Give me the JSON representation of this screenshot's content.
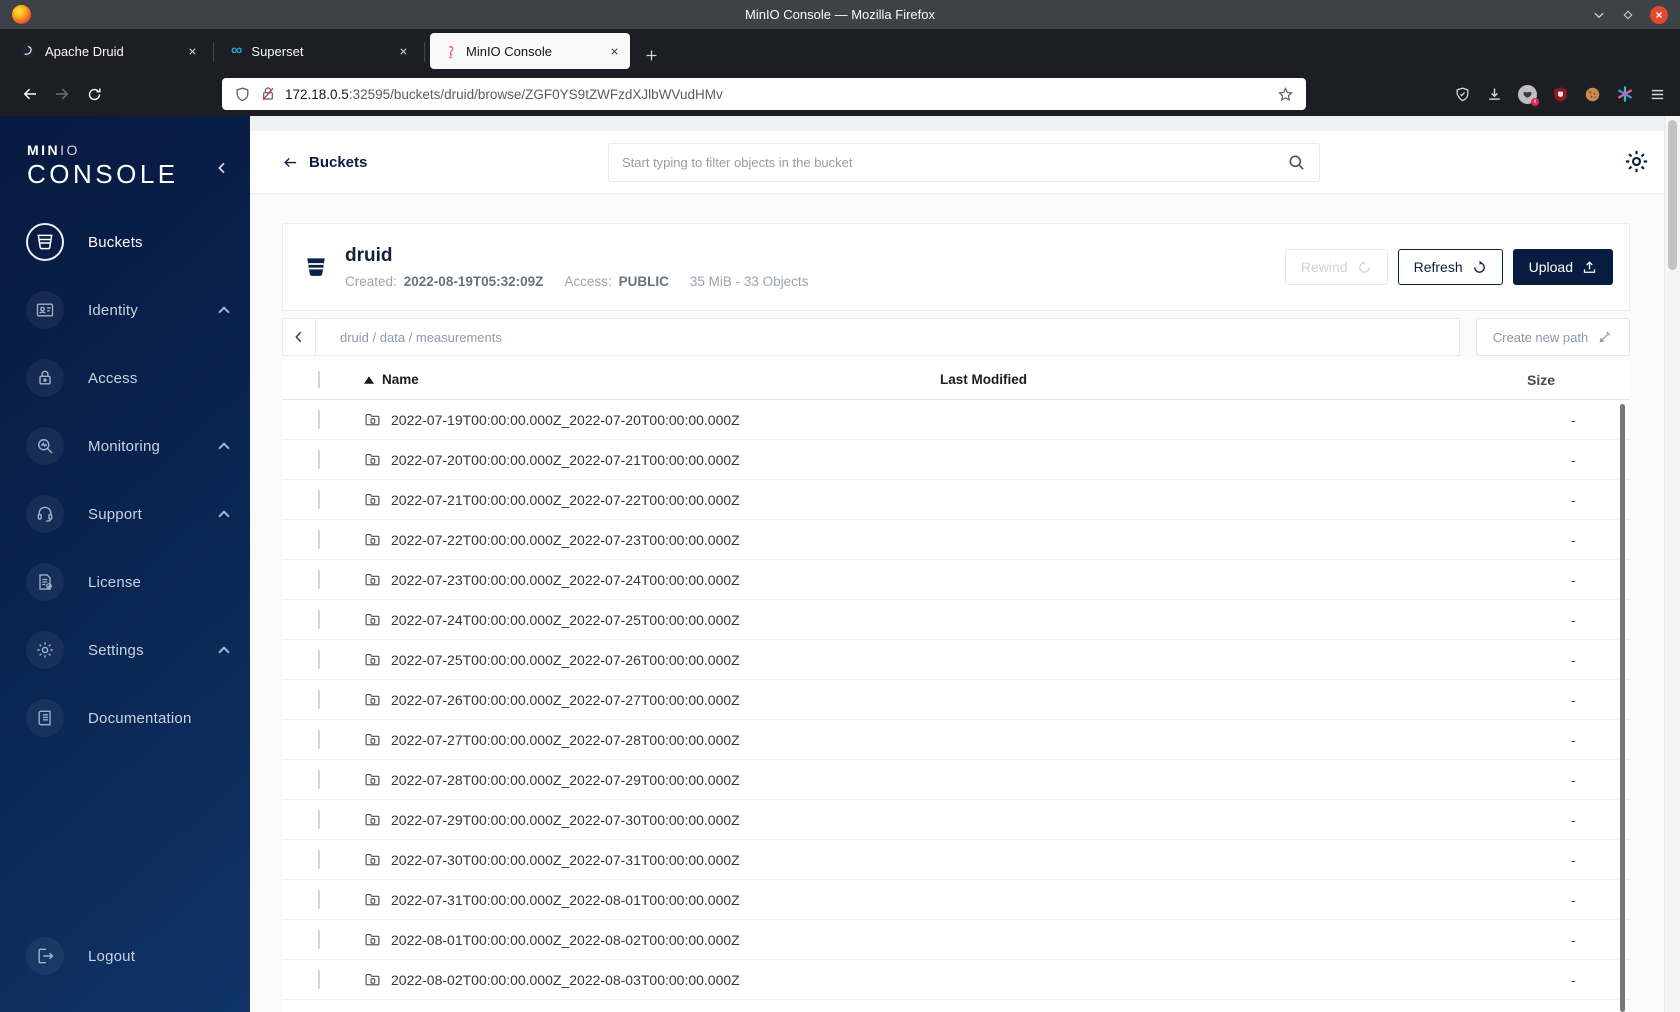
{
  "window": {
    "title": "MinIO Console — Mozilla Firefox"
  },
  "tabs": [
    {
      "label": "Apache Druid"
    },
    {
      "label": "Superset"
    },
    {
      "label": "MinIO Console",
      "active": true
    }
  ],
  "urlbar": {
    "host": "172.18.0.5",
    "rest": ":32595/buckets/druid/browse/ZGF0YS9tZWFzdXJlbWVudHMv"
  },
  "sidebar": {
    "logo_primary": "MIN",
    "logo_secondary": "IO",
    "logo_word": "CONSOLE",
    "items": [
      {
        "label": "Buckets",
        "icon": "bucket",
        "active": true,
        "expandable": false
      },
      {
        "label": "Identity",
        "icon": "identity",
        "active": false,
        "expandable": true
      },
      {
        "label": "Access",
        "icon": "access",
        "active": false,
        "expandable": false
      },
      {
        "label": "Monitoring",
        "icon": "monitoring",
        "active": false,
        "expandable": true
      },
      {
        "label": "Support",
        "icon": "support",
        "active": false,
        "expandable": true
      },
      {
        "label": "License",
        "icon": "license",
        "active": false,
        "expandable": false
      },
      {
        "label": "Settings",
        "icon": "settings",
        "active": false,
        "expandable": true
      },
      {
        "label": "Documentation",
        "icon": "documentation",
        "active": false,
        "expandable": false
      }
    ],
    "logout_label": "Logout"
  },
  "header": {
    "back_label": "Buckets",
    "search_placeholder": "Start typing to filter objects in the bucket"
  },
  "bucket": {
    "name": "druid",
    "created_label": "Created:",
    "created_value": "2022-08-19T05:32:09Z",
    "access_label": "Access:",
    "access_value": "PUBLIC",
    "usage": "35 MiB - 33 Objects",
    "actions": {
      "rewind": "Rewind",
      "refresh": "Refresh",
      "upload": "Upload"
    }
  },
  "browse": {
    "breadcrumb": "druid / data / measurements",
    "create_path_label": "Create new path",
    "columns": {
      "name": "Name",
      "last_modified": "Last Modified",
      "size": "Size"
    },
    "rows": [
      {
        "name": "2022-07-19T00:00:00.000Z_2022-07-20T00:00:00.000Z",
        "size": "-"
      },
      {
        "name": "2022-07-20T00:00:00.000Z_2022-07-21T00:00:00.000Z",
        "size": "-"
      },
      {
        "name": "2022-07-21T00:00:00.000Z_2022-07-22T00:00:00.000Z",
        "size": "-"
      },
      {
        "name": "2022-07-22T00:00:00.000Z_2022-07-23T00:00:00.000Z",
        "size": "-"
      },
      {
        "name": "2022-07-23T00:00:00.000Z_2022-07-24T00:00:00.000Z",
        "size": "-"
      },
      {
        "name": "2022-07-24T00:00:00.000Z_2022-07-25T00:00:00.000Z",
        "size": "-"
      },
      {
        "name": "2022-07-25T00:00:00.000Z_2022-07-26T00:00:00.000Z",
        "size": "-"
      },
      {
        "name": "2022-07-26T00:00:00.000Z_2022-07-27T00:00:00.000Z",
        "size": "-"
      },
      {
        "name": "2022-07-27T00:00:00.000Z_2022-07-28T00:00:00.000Z",
        "size": "-"
      },
      {
        "name": "2022-07-28T00:00:00.000Z_2022-07-29T00:00:00.000Z",
        "size": "-"
      },
      {
        "name": "2022-07-29T00:00:00.000Z_2022-07-30T00:00:00.000Z",
        "size": "-"
      },
      {
        "name": "2022-07-30T00:00:00.000Z_2022-07-31T00:00:00.000Z",
        "size": "-"
      },
      {
        "name": "2022-07-31T00:00:00.000Z_2022-08-01T00:00:00.000Z",
        "size": "-"
      },
      {
        "name": "2022-08-01T00:00:00.000Z_2022-08-02T00:00:00.000Z",
        "size": "-"
      },
      {
        "name": "2022-08-02T00:00:00.000Z_2022-08-03T00:00:00.000Z",
        "size": "-"
      }
    ]
  },
  "colors": {
    "accent_navy": "#081C42",
    "sidebar_gradient_start": "#071940",
    "sidebar_gradient_end": "#103468",
    "active_tab_bg": "#f9f9fa",
    "chrome_dark": "#1c1e24",
    "close_button": "#e2492f"
  }
}
